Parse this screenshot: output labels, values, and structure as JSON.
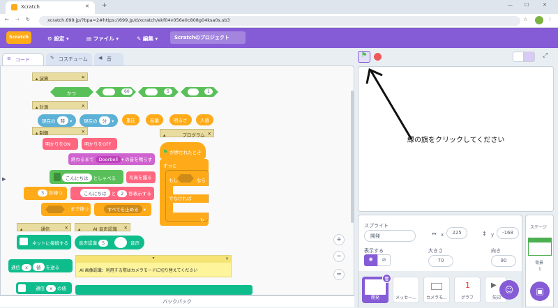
{
  "browser": {
    "tab_title": "Xcratch",
    "url": "xcratch.699.jp/?bpa=2#https://699.jp/d/xcratch/ekf04v056e0c808g04ksa0s.sb3"
  },
  "menu": {
    "logo": "Scratch",
    "settings": "設定",
    "file": "ファイル",
    "edit": "編集",
    "project_title": "Scratchのプロジェクト"
  },
  "editor_tabs": {
    "code": "コード",
    "costume": "コスチューム",
    "sound": "音"
  },
  "blocks": {
    "h_calc": "演算",
    "and": "かつ",
    "lt_val": "60",
    "eq_val": "5",
    "gt_val": "1",
    "h_measure": "計測",
    "hour_a": "現在の",
    "hour_b": "時",
    "minute_a": "現在の",
    "minute_b": "分",
    "pressure": "重圧",
    "volume": "音量",
    "brightness": "明るさ",
    "presence": "人感",
    "h_control": "制御",
    "light_on": "明かりをON",
    "light_off": "明かりをOFF",
    "play_until_a": "終わるまで",
    "play_until_sound": "Doorbell",
    "play_until_b": "の音を鳴らす",
    "say_a": "こんにちは",
    "say_b": "としゃべる",
    "photo": "写真を撮る",
    "wait_a": "3",
    "wait_b": "秒待つ",
    "say_for_a": "こんにちは",
    "say_for_b": "と",
    "say_for_c": "2",
    "say_for_d": "秒表示する",
    "wait_until": "まで待つ",
    "stop_all": "すべてを止める",
    "h_program": "プログラム",
    "when_flag": "が押されたとき",
    "forever": "ずっと",
    "if": "もし",
    "then": "なら",
    "else": "でなければ",
    "h_comm": "通信",
    "connect": "ネットに接続する",
    "h_ai": "AI 音声認識",
    "voice_recog": "音声認識",
    "voice_n": "5",
    "voice": "音声",
    "comm_x": "x",
    "comm_val": "値",
    "comm_send": "を送る",
    "comm_prefix": "通信",
    "comm2_prefix": "通信",
    "comm2_x": "x",
    "comm2_suffix": "の値",
    "note": "AI 画像認識：利用する際はカメラモードに切り替えてください"
  },
  "backpack": "バックパック",
  "annotation": "緑の旗をクリックしてください",
  "sprite": {
    "label": "スプライト",
    "name": "開発",
    "x_label": "x",
    "x": "225",
    "y_label": "y",
    "y": "-168",
    "show_label": "表示する",
    "size_label": "大きさ",
    "size": "70",
    "dir_label": "向き",
    "dir": "90"
  },
  "sprites": [
    "開発",
    "メッセー...",
    "カメラモ...",
    "グラフ",
    "矢印"
  ],
  "stage_panel": {
    "label": "ステージ",
    "bg_label": "背景",
    "bg_count": "1"
  },
  "colors": {
    "menu": "#855cd6",
    "control": "#ffab19",
    "sensing": "#5cb1d6",
    "op": "#59c059"
  }
}
